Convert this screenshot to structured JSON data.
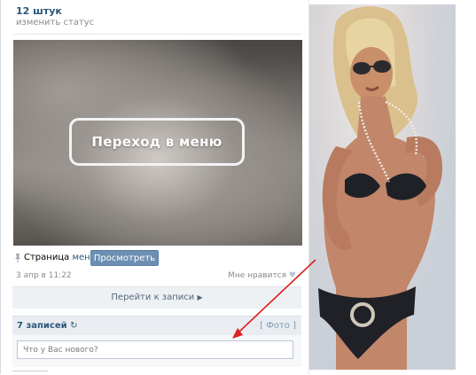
{
  "status": {
    "title": "12 штук",
    "change_status": "изменить статус"
  },
  "post": {
    "image_caption": "Переход в меню",
    "page_label": "Страница",
    "page_link": "меню",
    "view_button": "Просмотреть",
    "date": "3 апр в 11:22",
    "likes": "Мне нравится",
    "goto_record": "Перейти к записи"
  },
  "wall": {
    "count": "7 записей",
    "refresh": "↻",
    "photo_link": "[ Фото ]",
    "input_placeholder": "Что у Вас нового?"
  },
  "colors": {
    "link": "#2b587a",
    "button": "#6d8fb3",
    "arrow": "#e02020"
  }
}
